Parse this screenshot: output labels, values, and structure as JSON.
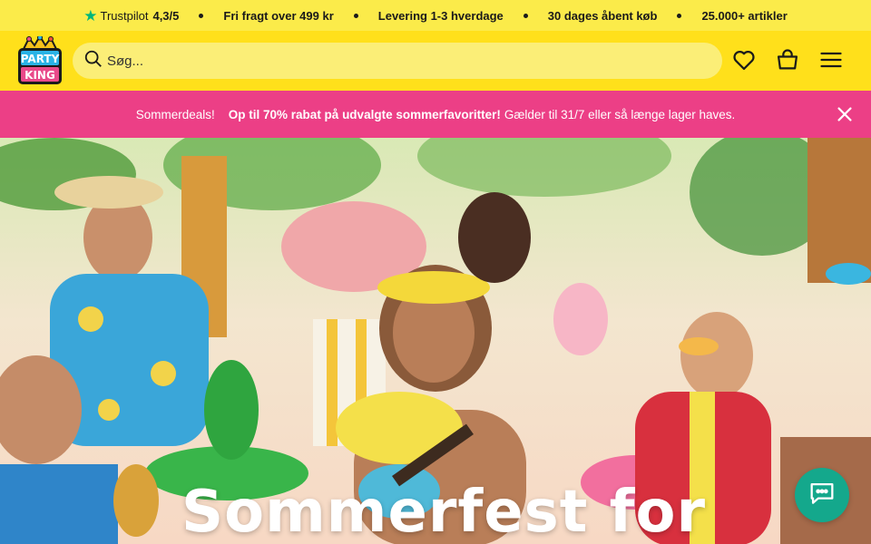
{
  "topbar": {
    "trustpilot_name": "Trustpilot",
    "trustpilot_score": "4,3/5",
    "items": [
      "Fri fragt over 499 kr",
      "Levering 1-3 hverdage",
      "30 dages åbent køb",
      "25.000+ artikler"
    ]
  },
  "header": {
    "logo_text_top": "PARTY",
    "logo_text_bottom": "KING",
    "search_placeholder": "Søg...",
    "icons": [
      "search-icon",
      "heart-icon",
      "basket-icon",
      "menu-icon"
    ]
  },
  "promo": {
    "lead": "Sommerdeals!",
    "highlight": "Op til 70% rabat på udvalgte sommerfavoritter!",
    "rest": "Gælder til 31/7 eller så længe lager haves."
  },
  "hero": {
    "title": "Sommerfest for"
  },
  "colors": {
    "topbar_bg": "#fbeb4a",
    "header_bg": "#ffe01b",
    "promo_bg": "#ec3f86",
    "chat_bg": "#14a88c",
    "trustpilot_star": "#00b67a"
  }
}
